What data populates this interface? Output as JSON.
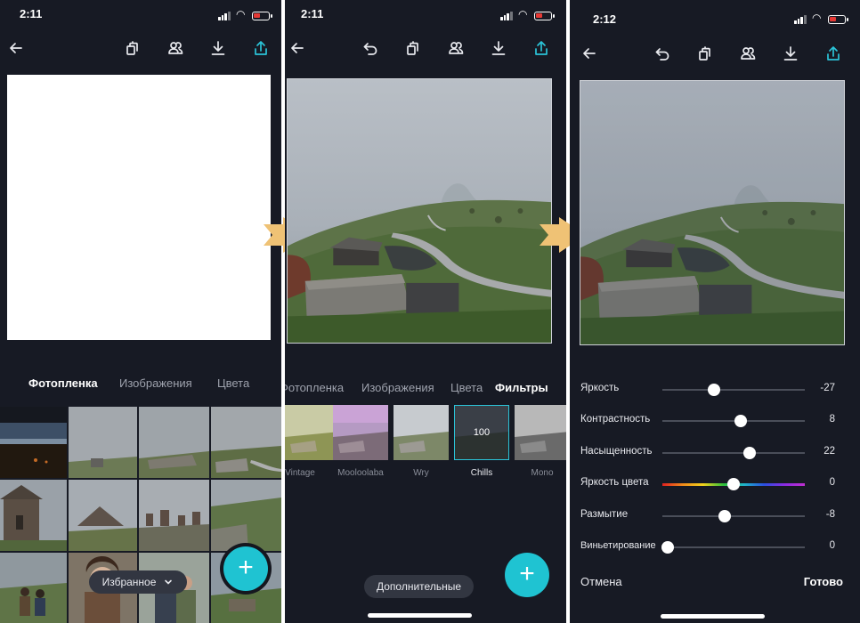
{
  "screens": [
    {
      "time": "2:11",
      "tabs": [
        "Фотопленка",
        "Изображения",
        "Цвета"
      ],
      "active_tab": 0,
      "favorites_label": "Избранное",
      "fab_label": "+"
    },
    {
      "time": "2:11",
      "tabs": [
        "Фотопленка",
        "Изображения",
        "Цвета",
        "Фильтры"
      ],
      "active_tab": 3,
      "filters": [
        {
          "name": "Vintage"
        },
        {
          "name": "Mooloolaba"
        },
        {
          "name": "Wry"
        },
        {
          "name": "Chills",
          "value": "100",
          "selected": true
        },
        {
          "name": "Mono"
        }
      ],
      "more_label": "Дополнительные",
      "fab_label": "+"
    },
    {
      "time": "2:12",
      "adjustments": [
        {
          "label": "Яркость",
          "value": "-27",
          "level": 0.365
        },
        {
          "label": "Контрастность",
          "value": "8",
          "level": 0.55
        },
        {
          "label": "Насыщенность",
          "value": "22",
          "level": 0.61
        },
        {
          "label": "Яркость цвета",
          "value": "0",
          "level": 0.5,
          "hue": true
        },
        {
          "label": "Размытие",
          "value": "-8",
          "level": 0.44
        },
        {
          "label": "Виньетирование",
          "value": "0",
          "level": 0.04
        }
      ],
      "cancel_label": "Отмена",
      "done_label": "Готово"
    }
  ],
  "colors": {
    "background": "#171a24",
    "accent": "#1fc3d2",
    "arrow": "#efc275"
  },
  "icons": [
    "back-arrow-icon",
    "undo-icon",
    "layers-icon",
    "collaborate-icon",
    "download-icon",
    "share-icon",
    "chevron-down-icon",
    "plus-icon",
    "next-arrow-icon"
  ]
}
